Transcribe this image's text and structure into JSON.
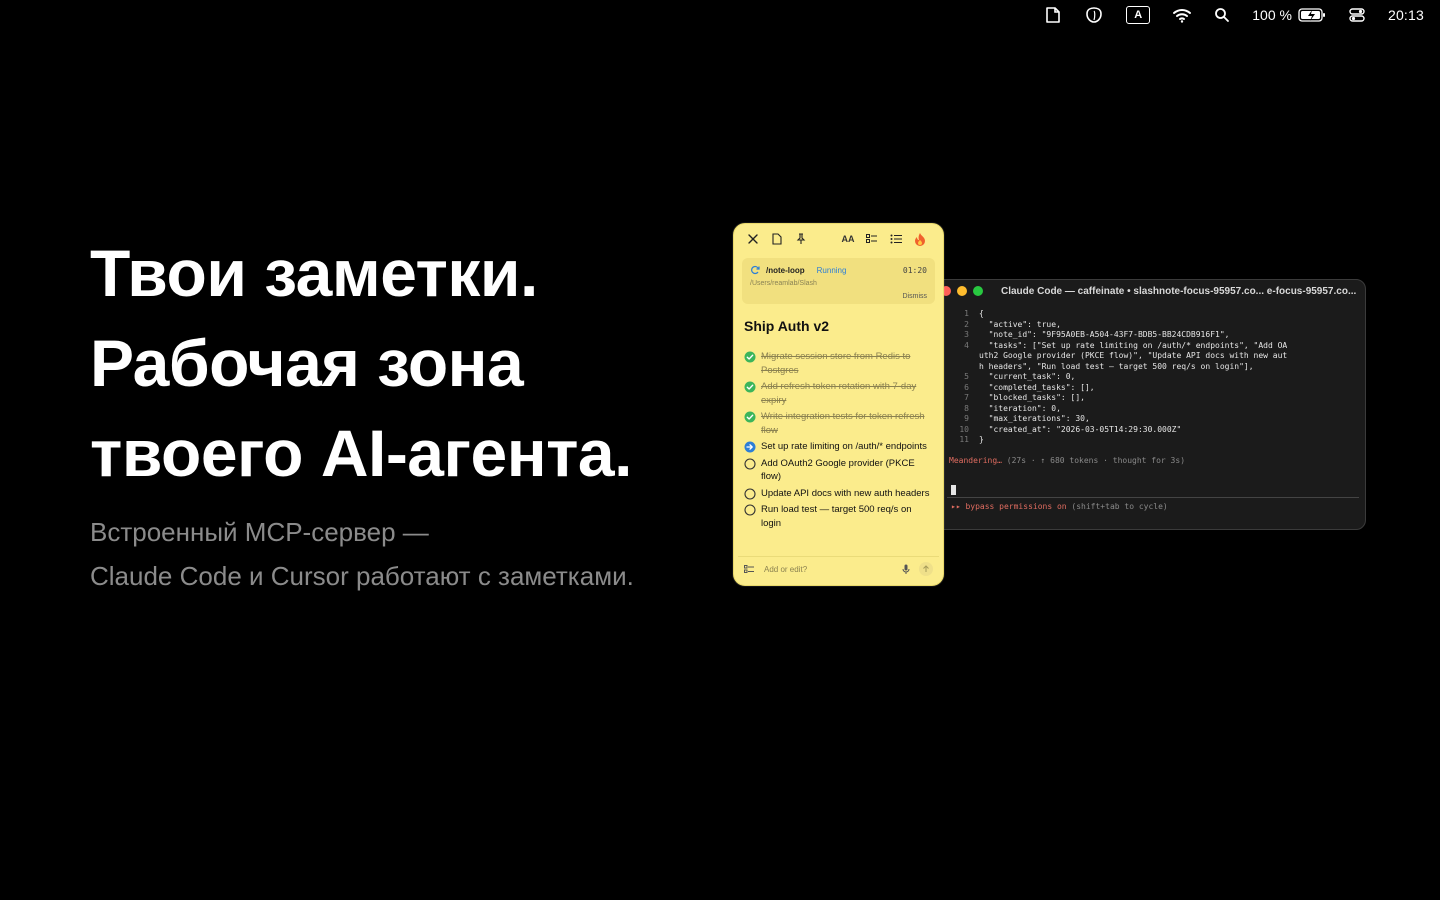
{
  "menubar": {
    "battery_percent": "100 %",
    "clock": "20:13",
    "input_source": "A",
    "icons": [
      "note-icon",
      "shield-icon",
      "keyboard-input-icon",
      "wifi-icon",
      "search-icon",
      "battery-icon",
      "control-center-icon"
    ]
  },
  "hero": {
    "line1": "Твои заметки.",
    "line2": "Рабочая зона",
    "line3": "твоего AI-агента.",
    "sub1": "Встроенный MCP-сервер —",
    "sub2": "Claude Code и Cursor работают с заметками."
  },
  "note": {
    "toolbar": {
      "font_label": "AA"
    },
    "loop": {
      "name": "/note-loop",
      "status": "Running",
      "time": "01:20",
      "path": "/Users/reamlab/Slash",
      "dismiss": "Dismiss"
    },
    "title": "Ship Auth v2",
    "tasks": [
      {
        "text": "Migrate session store from Redis to Postgres",
        "state": "done"
      },
      {
        "text": "Add refresh token rotation with 7-day expiry",
        "state": "done"
      },
      {
        "text": "Write integration tests for token refresh flow",
        "state": "done"
      },
      {
        "text": "Set up rate limiting on /auth/* endpoints",
        "state": "active"
      },
      {
        "text": "Add OAuth2 Google provider (PKCE flow)",
        "state": "todo"
      },
      {
        "text": "Update API docs with new auth headers",
        "state": "todo"
      },
      {
        "text": "Run load test — target 500 req/s on login",
        "state": "todo"
      }
    ],
    "input_placeholder": "Add or edit?",
    "colors": {
      "background": "#fbec8c",
      "done_check": "#3bb55b",
      "active": "#2d7fd6"
    }
  },
  "terminal": {
    "title": "Claude Code — caffeinate • slashnote-focus-95957.co... e-focus-95957.co...",
    "lines": [
      {
        "n": "1",
        "t": "{"
      },
      {
        "n": "2",
        "t": "  \"active\": true,"
      },
      {
        "n": "3",
        "t": "  \"note_id\": \"9F95A0EB-A504-43F7-BDB5-BB24CDB916F1\","
      },
      {
        "n": "4",
        "t": "  \"tasks\": [\"Set up rate limiting on /auth/* endpoints\", \"Add OA"
      },
      {
        "n": "",
        "t": "uth2 Google provider (PKCE flow)\", \"Update API docs with new aut"
      },
      {
        "n": "",
        "t": "h headers\", \"Run load test — target 500 req/s on login\"],"
      },
      {
        "n": "5",
        "t": "  \"current_task\": 0,"
      },
      {
        "n": "6",
        "t": "  \"completed_tasks\": [],"
      },
      {
        "n": "7",
        "t": "  \"blocked_tasks\": [],"
      },
      {
        "n": "8",
        "t": "  \"iteration\": 0,"
      },
      {
        "n": "9",
        "t": "  \"max_iterations\": 30,"
      },
      {
        "n": "10",
        "t": "  \"created_at\": \"2026-03-05T14:29:30.000Z\""
      },
      {
        "n": "11",
        "t": "}"
      }
    ],
    "status_word": "Meandering…",
    "status_rest": " (27s · ↑ 680 tokens · thought for 3s)",
    "bypass_warn": "▸▸ bypass permissions on",
    "bypass_rest": " (shift+tab to cycle)",
    "colors": {
      "close": "#ff5f57",
      "minimize": "#febc2e",
      "zoom": "#28c840",
      "warn": "#e06c60"
    }
  }
}
